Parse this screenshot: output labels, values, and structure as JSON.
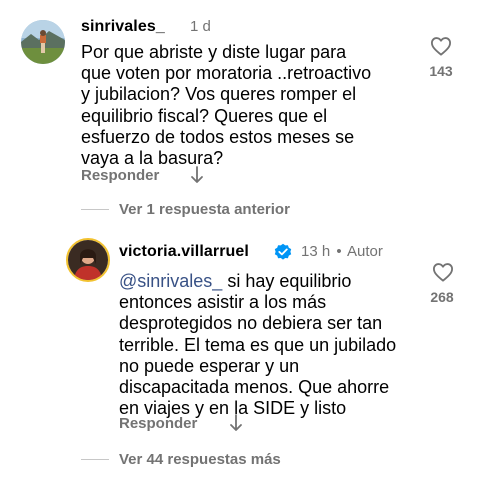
{
  "comments": [
    {
      "username": "sinrivales_",
      "time": "1 d",
      "text": "Por que abriste  y diste lugar para que voten por moratoria ..retroactivo y jubilacion? Vos queres romper el equilibrio fiscal? Queres que el esfuerzo de todos estos meses se vaya a la basura?",
      "likes": "143",
      "reply_label": "Responder"
    },
    {
      "username": "victoria.villarruel",
      "verified": true,
      "time": "13 h",
      "separator": "•",
      "author_tag": "Autor",
      "mention": "@sinrivales_",
      "text": " si hay equilibrio entonces asistir a los más desprotegidos no debiera ser tan terrible. El tema es que un jubilado no puede esperar y un discapacitada menos. Que ahorre en viajes y en la SIDE y listo",
      "likes": "268",
      "reply_label": "Responder"
    }
  ],
  "view_previous_replies": "Ver 1 respuesta anterior",
  "view_more_replies": "Ver 44 respuestas más",
  "colors": {
    "text": "#000000",
    "secondary": "#737373",
    "mention": "#385185",
    "verified": "#0095f6",
    "divider": "#c7c7c7"
  },
  "icons": [
    "heart-icon",
    "arrow-down-icon",
    "verified-badge-icon"
  ]
}
